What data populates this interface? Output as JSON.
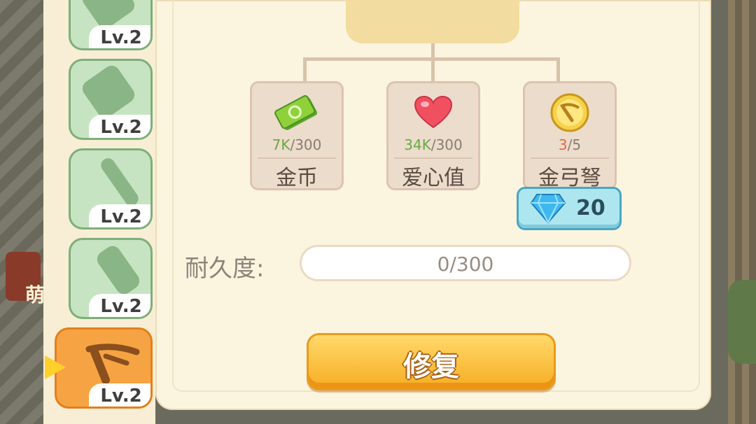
{
  "side_tabs": [
    {
      "level": "Lv.2",
      "icon": "hammer-icon"
    },
    {
      "level": "Lv.2",
      "icon": "pickaxe-icon"
    },
    {
      "level": "Lv.2",
      "icon": "shovel-icon"
    },
    {
      "level": "Lv.2",
      "icon": "drill-icon"
    },
    {
      "level": "Lv.2",
      "icon": "crossbow-icon",
      "active": true
    }
  ],
  "background_text": "萌",
  "requirements": [
    {
      "icon": "money-icon",
      "current": "7K",
      "total": "/300",
      "name": "金币"
    },
    {
      "icon": "heart-icon",
      "current": "34K",
      "total": "/300",
      "name": "爱心值"
    },
    {
      "icon": "golden-crossbow-icon",
      "current": "3",
      "total": "/5",
      "name": "金弓弩"
    }
  ],
  "gem_cost": {
    "icon": "diamond-icon",
    "value": "20"
  },
  "durability": {
    "label": "耐久度:",
    "value": "0/300",
    "fraction": 0
  },
  "repair_button": {
    "label": "修复"
  },
  "colors": {
    "accent_orange": "#f7ad22",
    "gem_blue": "#aee6f0",
    "ok_green": "#6aa845",
    "lack_red": "#e46a4b"
  }
}
